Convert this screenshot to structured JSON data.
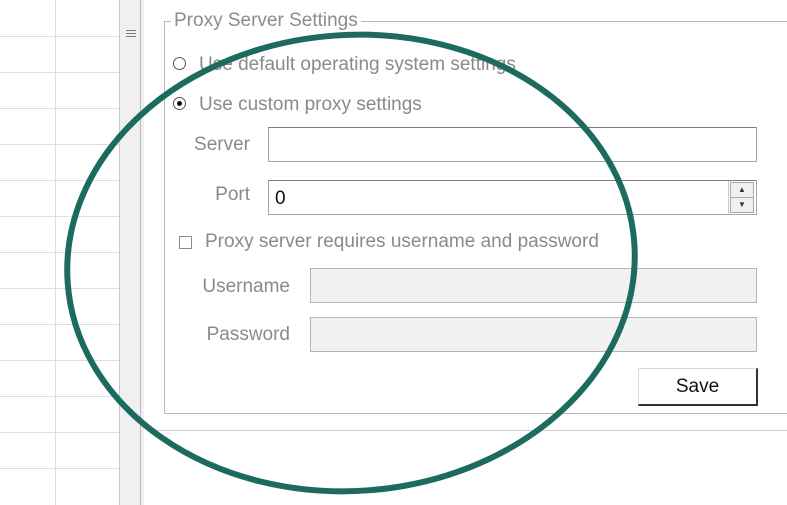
{
  "proxy_settings": {
    "group_title": "Proxy Server Settings",
    "option_default": "Use default operating system settings",
    "option_custom": "Use custom proxy settings",
    "selected_option": "custom",
    "server_label": "Server",
    "server_value": "",
    "port_label": "Port",
    "port_value": "0",
    "auth_checkbox_label": "Proxy server requires username and password",
    "auth_checked": false,
    "username_label": "Username",
    "username_value": "",
    "password_label": "Password",
    "password_value": "",
    "save_label": "Save"
  },
  "icons": {
    "splitter_grip": "grip-lines-icon",
    "spin_up": "arrow-up-icon",
    "spin_down": "arrow-down-icon"
  },
  "colors": {
    "annotation_circle": "#1c6b5e",
    "disabled_text": "#8a8a8a",
    "border": "#a5a5a5"
  }
}
